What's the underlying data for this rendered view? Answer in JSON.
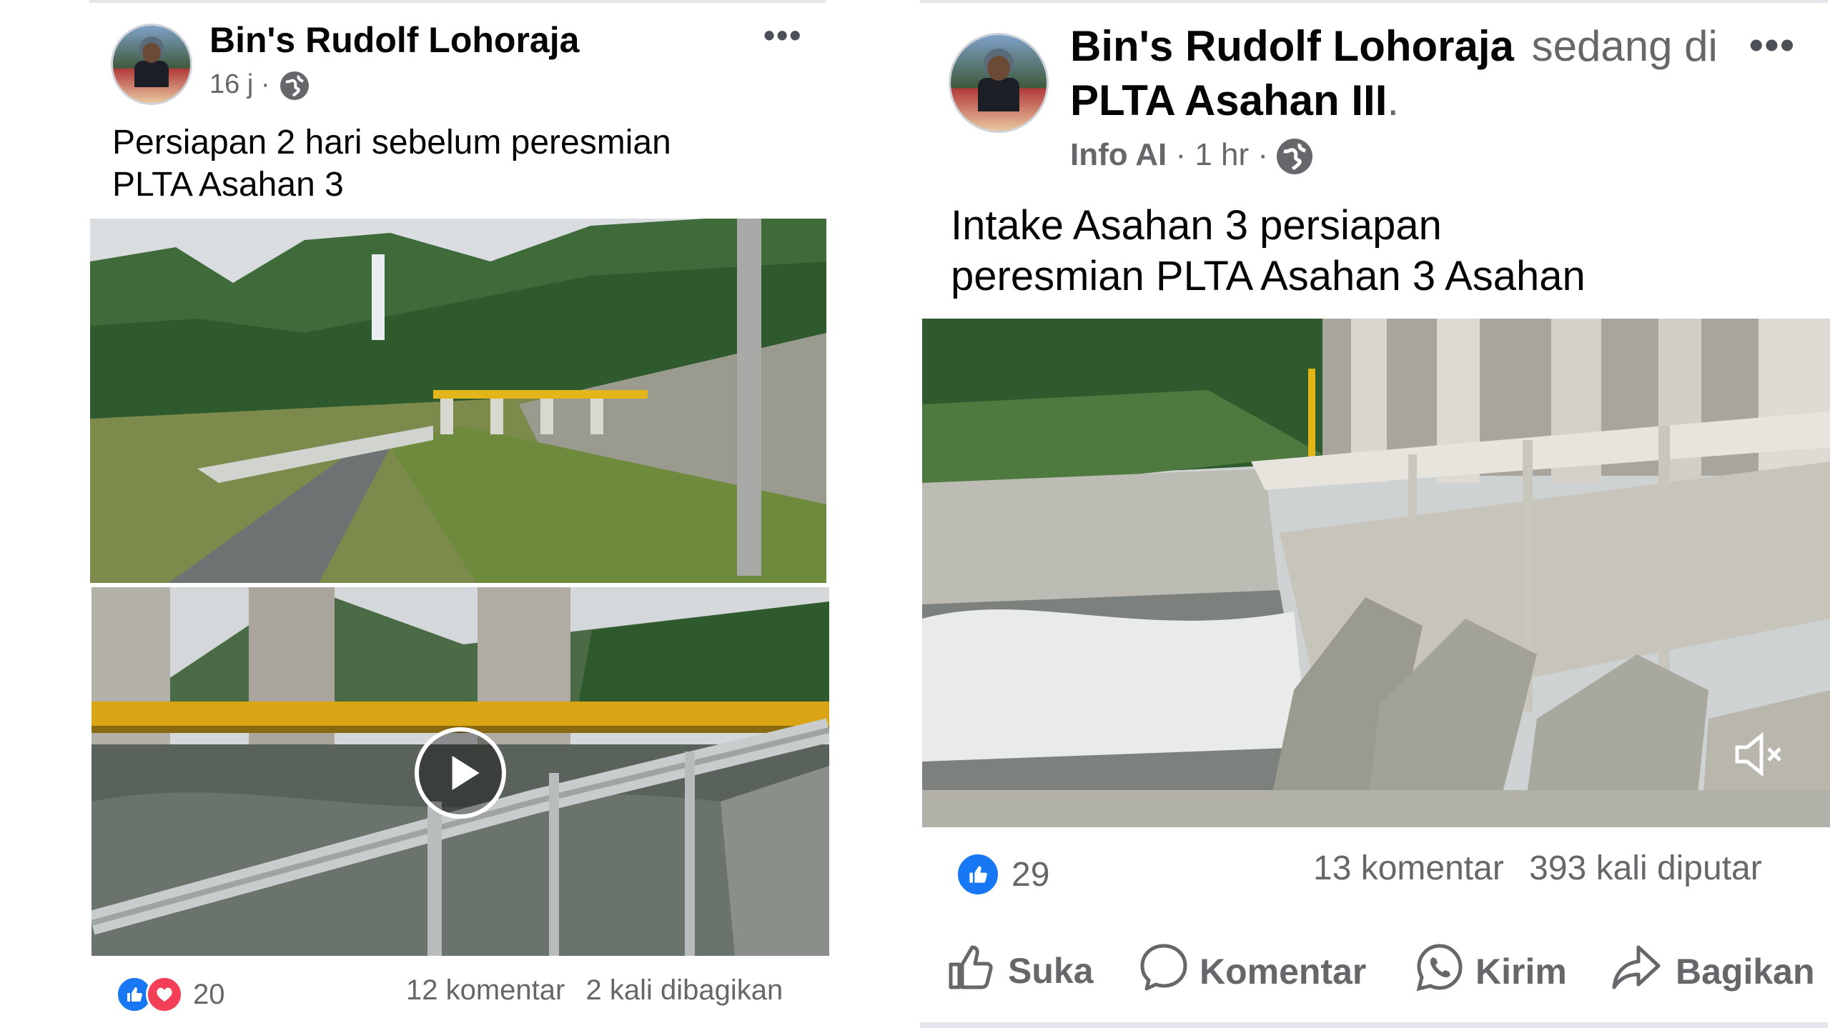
{
  "left_post": {
    "author": "Bin's Rudolf Lohoraja",
    "time": "16 j",
    "separator": "·",
    "caption": "Persiapan 2 hari sebelum peresmian\nPLTA Asahan 3",
    "more_icon": "more-dots-icon",
    "privacy_icon": "globe-icon",
    "reaction_count": "20",
    "comments": "12 komentar",
    "shares": "2 kali dibagikan"
  },
  "right_post": {
    "author": "Bin's Rudolf Lohoraja",
    "checkin_text": "sedang di",
    "place": "PLTA Asahan III",
    "place_period": ".",
    "info_label": "Info AI",
    "time": "1 hr",
    "separator": "·",
    "caption": "Intake Asahan 3 persiapan\n peresmian PLTA Asahan 3 Asahan",
    "reaction_count": "29",
    "comments": "13 komentar",
    "views": "393 kali diputar",
    "actions": {
      "like": "Suka",
      "comment": "Komentar",
      "send": "Kirim",
      "share": "Bagikan"
    }
  },
  "colors": {
    "facebook_blue": "#1877f2",
    "love_red": "#f33e58",
    "secondary_text": "#65676b"
  }
}
